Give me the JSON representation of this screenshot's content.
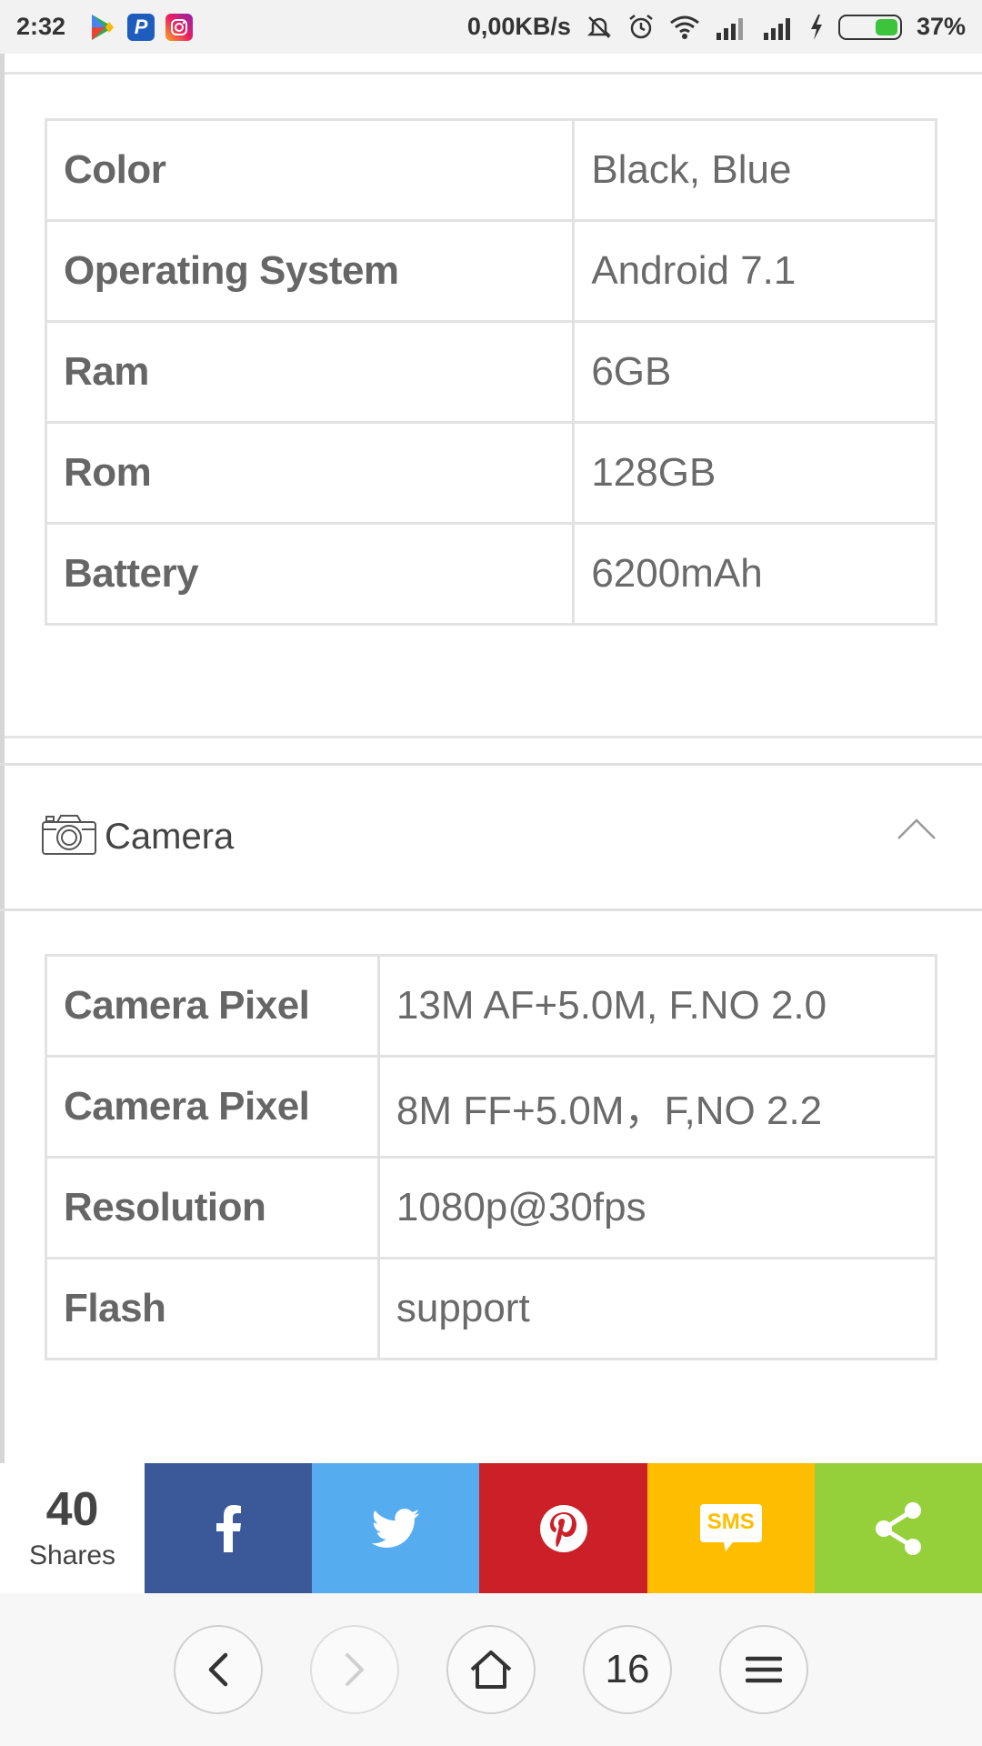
{
  "status_bar": {
    "time": "2:32",
    "net_speed": "0,00KB/s",
    "battery_percent": "37%",
    "battery_level": 0.37,
    "app_icons": [
      "play-store-icon",
      "paypal-icon",
      "instagram-icon"
    ],
    "indicators": [
      "mute-icon",
      "alarm-icon",
      "wifi-icon",
      "signal-1-icon",
      "signal-2-icon",
      "charging-icon",
      "battery-icon"
    ]
  },
  "general_specs": [
    {
      "label": "Color",
      "value": "Black, Blue"
    },
    {
      "label": "Operating System",
      "value": "Android 7.1"
    },
    {
      "label": "Ram",
      "value": "6GB"
    },
    {
      "label": "Rom",
      "value": "128GB"
    },
    {
      "label": "Battery",
      "value": "6200mAh"
    }
  ],
  "camera_section": {
    "title": "Camera",
    "icon": "camera-icon",
    "toggle_icon": "chevron-up-icon",
    "specs": [
      {
        "label": "Camera Pixel",
        "value": "13M AF+5.0M, F.NO 2.0"
      },
      {
        "label": "Camera Pixel",
        "value": "8M FF+5.0M，F,NO 2.2"
      },
      {
        "label": "Resolution",
        "value": "1080p@30fps"
      },
      {
        "label": "Flash",
        "value": "support"
      }
    ]
  },
  "share_bar": {
    "count": "40",
    "count_label": "Shares",
    "buttons": [
      {
        "name": "facebook",
        "icon": "facebook-icon",
        "color": "#3b5998"
      },
      {
        "name": "twitter",
        "icon": "twitter-icon",
        "color": "#55acee"
      },
      {
        "name": "pinterest",
        "icon": "pinterest-icon",
        "color": "#cb2027"
      },
      {
        "name": "sms",
        "icon": "sms-icon",
        "label": "SMS",
        "color": "#ffbd00"
      },
      {
        "name": "share",
        "icon": "share-icon",
        "color": "#95d03a"
      }
    ]
  },
  "browser_nav": {
    "tabs_count": "16",
    "buttons": [
      "back-icon",
      "forward-icon",
      "home-icon",
      "tabs-button",
      "menu-icon"
    ]
  }
}
